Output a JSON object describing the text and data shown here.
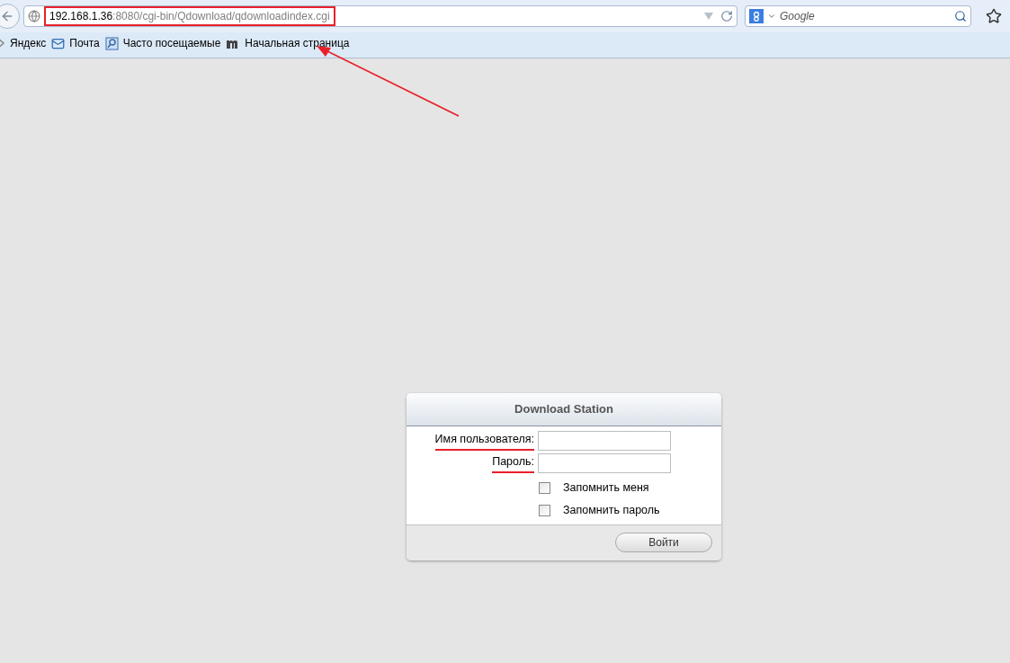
{
  "address_bar": {
    "host": "192.168.1.36",
    "rest": ":8080/cgi-bin/Qdownload/qdownloadindex.cgi",
    "highlighted": true
  },
  "search": {
    "placeholder": "Google"
  },
  "bookmarks": [
    "Яндекс",
    "Почта",
    "Часто посещаемые",
    "Начальная страница"
  ],
  "login": {
    "title": "Download Station",
    "fields": [
      {
        "label": "Имя пользователя:",
        "underlined": true
      },
      {
        "label": "Пароль:",
        "underlined": true
      }
    ],
    "checkboxes": [
      {
        "label": "Запомнить меня",
        "checked": false
      },
      {
        "label": "Запомнить пароль",
        "checked": false
      }
    ],
    "button": "Войти"
  }
}
